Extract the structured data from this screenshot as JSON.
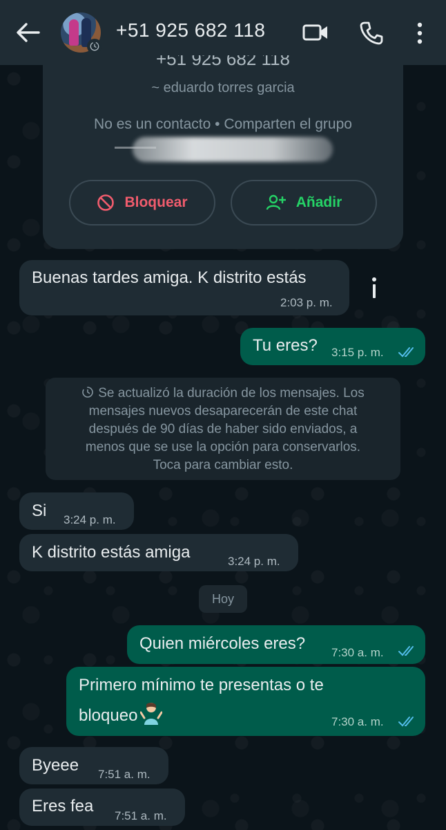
{
  "header": {
    "title": "+51 925 682 118",
    "icons": [
      "back-arrow-icon",
      "avatar",
      "video-call-icon",
      "voice-call-icon",
      "more-options-icon"
    ]
  },
  "contact_card": {
    "number_partial": "+51 925 682 118",
    "name": "~ eduardo torres garcia",
    "status": "No es un contacto • Comparten el grupo",
    "block_label": "Bloquear",
    "add_label": "Añadir"
  },
  "messages": [
    {
      "dir": "in",
      "text": "Buenas tardes amiga. K distrito estás",
      "time": "2:03 p. m."
    },
    {
      "dir": "out",
      "text": "Tu eres?",
      "time": "3:15 p. m.",
      "read": true
    },
    {
      "dir": "in",
      "text": "Si",
      "time": "3:24 p. m."
    },
    {
      "dir": "in",
      "text": "K distrito estás amiga",
      "time": "3:24 p. m."
    },
    {
      "dir": "out",
      "text": "Quien miércoles eres?",
      "time": "7:30 a. m.",
      "read": true
    },
    {
      "dir": "out",
      "text_line1": "Primero mínimo te presentas o te",
      "text_line2": "bloqueo",
      "emoji": "person-shrugging-emoji",
      "time": "7:30 a. m.",
      "read": true
    },
    {
      "dir": "in",
      "text": "Byeee",
      "time": "7:51 a. m."
    },
    {
      "dir": "in",
      "text": "Eres fea",
      "time": "7:51 a. m."
    }
  ],
  "system_message": {
    "line1": "Se actualizó la duración de los mensajes. Los",
    "line2": "mensajes nuevos desaparecerán de este chat",
    "line3": "después de 90 días de haber sido enviados, a",
    "line4": "menos que se use la opción para conservarlos.",
    "line5": "Toca para cambiar esto."
  },
  "day_divider": "Hoy",
  "colors": {
    "background": "#0b141a",
    "header": "#1f2c34",
    "incoming_bubble": "#1f2c34",
    "outgoing_bubble": "#005c4b",
    "block_red": "#f15c6d",
    "add_green": "#25d366",
    "read_ticks": "#53bdeb"
  }
}
